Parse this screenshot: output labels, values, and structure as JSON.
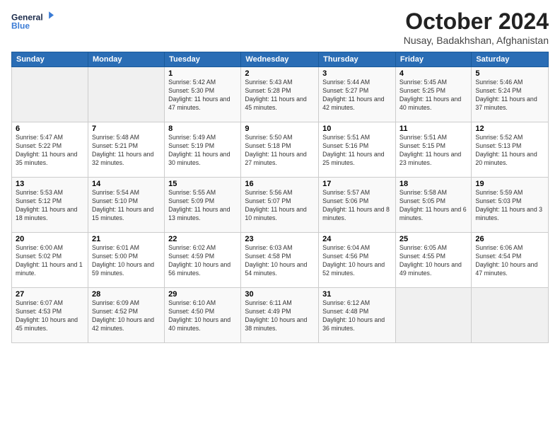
{
  "header": {
    "logo_line1": "General",
    "logo_line2": "Blue",
    "month_title": "October 2024",
    "location": "Nusay, Badakhshan, Afghanistan"
  },
  "weekdays": [
    "Sunday",
    "Monday",
    "Tuesday",
    "Wednesday",
    "Thursday",
    "Friday",
    "Saturday"
  ],
  "weeks": [
    [
      {
        "day": "",
        "info": ""
      },
      {
        "day": "",
        "info": ""
      },
      {
        "day": "1",
        "info": "Sunrise: 5:42 AM\nSunset: 5:30 PM\nDaylight: 11 hours and 47 minutes."
      },
      {
        "day": "2",
        "info": "Sunrise: 5:43 AM\nSunset: 5:28 PM\nDaylight: 11 hours and 45 minutes."
      },
      {
        "day": "3",
        "info": "Sunrise: 5:44 AM\nSunset: 5:27 PM\nDaylight: 11 hours and 42 minutes."
      },
      {
        "day": "4",
        "info": "Sunrise: 5:45 AM\nSunset: 5:25 PM\nDaylight: 11 hours and 40 minutes."
      },
      {
        "day": "5",
        "info": "Sunrise: 5:46 AM\nSunset: 5:24 PM\nDaylight: 11 hours and 37 minutes."
      }
    ],
    [
      {
        "day": "6",
        "info": "Sunrise: 5:47 AM\nSunset: 5:22 PM\nDaylight: 11 hours and 35 minutes."
      },
      {
        "day": "7",
        "info": "Sunrise: 5:48 AM\nSunset: 5:21 PM\nDaylight: 11 hours and 32 minutes."
      },
      {
        "day": "8",
        "info": "Sunrise: 5:49 AM\nSunset: 5:19 PM\nDaylight: 11 hours and 30 minutes."
      },
      {
        "day": "9",
        "info": "Sunrise: 5:50 AM\nSunset: 5:18 PM\nDaylight: 11 hours and 27 minutes."
      },
      {
        "day": "10",
        "info": "Sunrise: 5:51 AM\nSunset: 5:16 PM\nDaylight: 11 hours and 25 minutes."
      },
      {
        "day": "11",
        "info": "Sunrise: 5:51 AM\nSunset: 5:15 PM\nDaylight: 11 hours and 23 minutes."
      },
      {
        "day": "12",
        "info": "Sunrise: 5:52 AM\nSunset: 5:13 PM\nDaylight: 11 hours and 20 minutes."
      }
    ],
    [
      {
        "day": "13",
        "info": "Sunrise: 5:53 AM\nSunset: 5:12 PM\nDaylight: 11 hours and 18 minutes."
      },
      {
        "day": "14",
        "info": "Sunrise: 5:54 AM\nSunset: 5:10 PM\nDaylight: 11 hours and 15 minutes."
      },
      {
        "day": "15",
        "info": "Sunrise: 5:55 AM\nSunset: 5:09 PM\nDaylight: 11 hours and 13 minutes."
      },
      {
        "day": "16",
        "info": "Sunrise: 5:56 AM\nSunset: 5:07 PM\nDaylight: 11 hours and 10 minutes."
      },
      {
        "day": "17",
        "info": "Sunrise: 5:57 AM\nSunset: 5:06 PM\nDaylight: 11 hours and 8 minutes."
      },
      {
        "day": "18",
        "info": "Sunrise: 5:58 AM\nSunset: 5:05 PM\nDaylight: 11 hours and 6 minutes."
      },
      {
        "day": "19",
        "info": "Sunrise: 5:59 AM\nSunset: 5:03 PM\nDaylight: 11 hours and 3 minutes."
      }
    ],
    [
      {
        "day": "20",
        "info": "Sunrise: 6:00 AM\nSunset: 5:02 PM\nDaylight: 11 hours and 1 minute."
      },
      {
        "day": "21",
        "info": "Sunrise: 6:01 AM\nSunset: 5:00 PM\nDaylight: 10 hours and 59 minutes."
      },
      {
        "day": "22",
        "info": "Sunrise: 6:02 AM\nSunset: 4:59 PM\nDaylight: 10 hours and 56 minutes."
      },
      {
        "day": "23",
        "info": "Sunrise: 6:03 AM\nSunset: 4:58 PM\nDaylight: 10 hours and 54 minutes."
      },
      {
        "day": "24",
        "info": "Sunrise: 6:04 AM\nSunset: 4:56 PM\nDaylight: 10 hours and 52 minutes."
      },
      {
        "day": "25",
        "info": "Sunrise: 6:05 AM\nSunset: 4:55 PM\nDaylight: 10 hours and 49 minutes."
      },
      {
        "day": "26",
        "info": "Sunrise: 6:06 AM\nSunset: 4:54 PM\nDaylight: 10 hours and 47 minutes."
      }
    ],
    [
      {
        "day": "27",
        "info": "Sunrise: 6:07 AM\nSunset: 4:53 PM\nDaylight: 10 hours and 45 minutes."
      },
      {
        "day": "28",
        "info": "Sunrise: 6:09 AM\nSunset: 4:52 PM\nDaylight: 10 hours and 42 minutes."
      },
      {
        "day": "29",
        "info": "Sunrise: 6:10 AM\nSunset: 4:50 PM\nDaylight: 10 hours and 40 minutes."
      },
      {
        "day": "30",
        "info": "Sunrise: 6:11 AM\nSunset: 4:49 PM\nDaylight: 10 hours and 38 minutes."
      },
      {
        "day": "31",
        "info": "Sunrise: 6:12 AM\nSunset: 4:48 PM\nDaylight: 10 hours and 36 minutes."
      },
      {
        "day": "",
        "info": ""
      },
      {
        "day": "",
        "info": ""
      }
    ]
  ]
}
